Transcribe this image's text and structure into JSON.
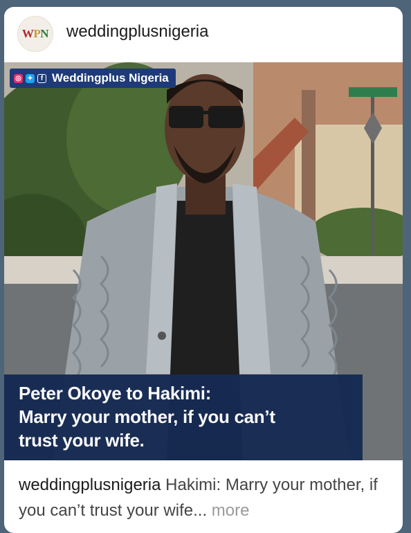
{
  "post": {
    "avatar_text": {
      "w": "W",
      "p": "P",
      "n": "N"
    },
    "username": "weddingplusnigeria"
  },
  "image": {
    "brand_label": "Weddingplus Nigeria",
    "headline_line1": "Peter Okoye to Hakimi:",
    "headline_line2": "Marry your mother, if you can’t",
    "headline_line3": "trust your wife."
  },
  "caption": {
    "user": "weddingplusnigeria",
    "text": " Hakimi: Marry your mother, if you can’t trust your wife",
    "ellipsis": "...",
    "more": " more"
  },
  "colors": {
    "background": "#4e6478",
    "headline_bg": "#162a52",
    "brand_tag_bg": "#1e3a78"
  }
}
